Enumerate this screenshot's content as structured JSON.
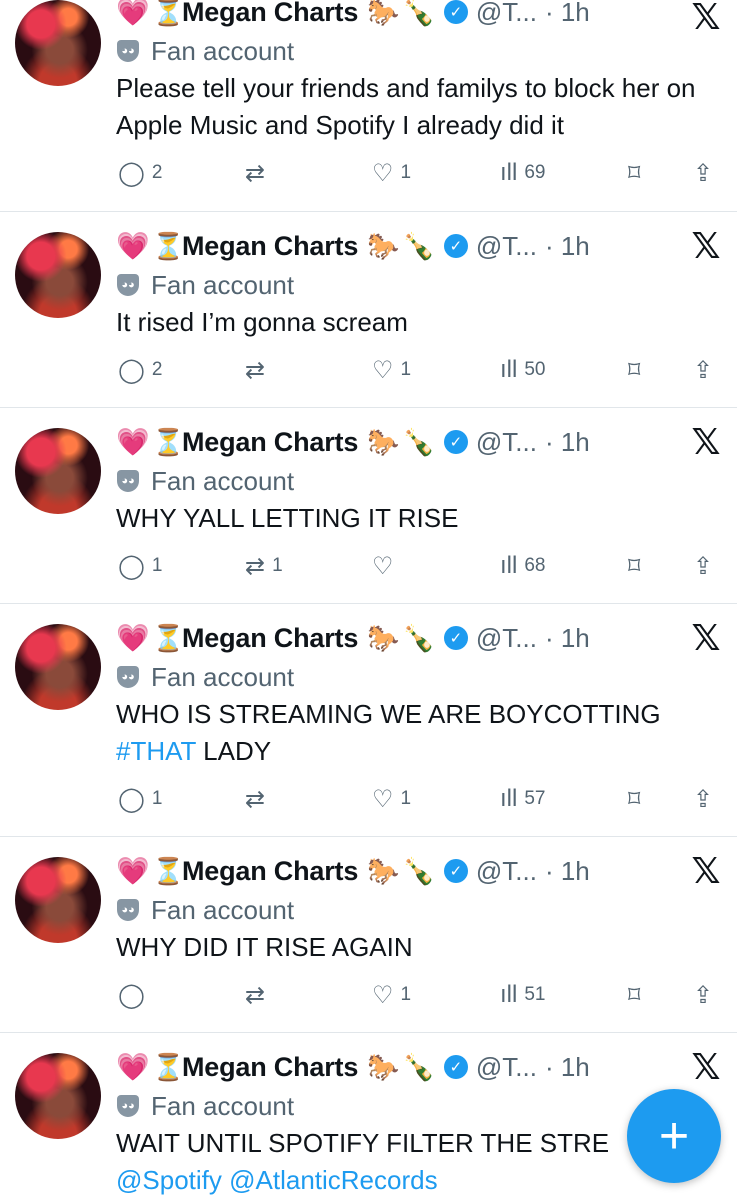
{
  "author": {
    "name": "Megan Charts",
    "handle": "@T...",
    "time": "· 1h",
    "label": "Fan account",
    "heart_emoji": "💗",
    "hourglass_emoji": "⏳",
    "horse_emoji": "🐎",
    "bottle_emoji": "🍾",
    "verified_glyph": "✓",
    "x_glyph": "𝕏"
  },
  "icons": {
    "reply": "reply-icon",
    "retweet": "retweet-icon",
    "like": "like-icon",
    "views": "views-icon",
    "bookmark": "bookmark-icon",
    "share": "share-icon",
    "glyphs": {
      "reply": "◯",
      "retweet": "⇄",
      "like": "♡",
      "views": "ıll",
      "bookmark": "⌑",
      "share": "⇪"
    }
  },
  "tweets": [
    {
      "text": "Please tell your friends and familys to block her on Apple Music and Spotify I already did it",
      "replies": "2",
      "retweets": "",
      "likes": "1",
      "views": "69"
    },
    {
      "text": "It rised I’m gonna scream",
      "replies": "2",
      "retweets": "",
      "likes": "1",
      "views": "50"
    },
    {
      "text": "WHY YALL LETTING IT RISE",
      "replies": "1",
      "retweets": "1",
      "likes": "",
      "views": "68"
    },
    {
      "text_before": "WHO IS STREAMING WE ARE BOYCOTTING",
      "hashtag": "#THAT",
      "text_after": " LADY",
      "replies": "1",
      "retweets": "",
      "likes": "1",
      "views": "57"
    },
    {
      "text": "WHY DID IT RISE AGAIN",
      "replies": "",
      "retweets": "",
      "likes": "1",
      "views": "51"
    },
    {
      "text": "WAIT UNTIL SPOTIFY FILTER THE STRE",
      "mention1": "@Spotify",
      "mention2": "@AtlanticRecords"
    }
  ],
  "fab": {
    "label": "+"
  },
  "colors": {
    "accent": "#1d9bf0",
    "muted": "#536471",
    "text": "#0f1419",
    "divider": "#e1e6ea"
  }
}
